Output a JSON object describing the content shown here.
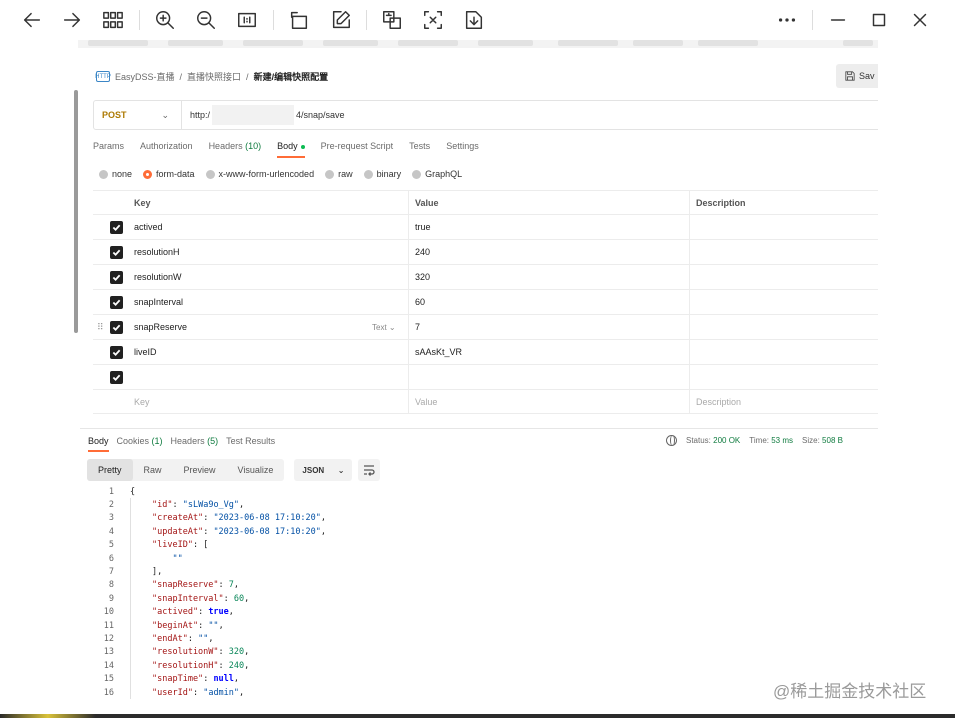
{
  "viewer": {
    "icons": [
      "back-arrow-icon",
      "forward-arrow-icon",
      "grid-view-icon",
      "zoom-in-icon",
      "zoom-out-icon",
      "actual-size-icon",
      "rotate-icon",
      "edit-icon",
      "translate-icon",
      "ocr-icon",
      "download-icon",
      "more-icon",
      "minimize-icon",
      "maximize-icon",
      "close-icon"
    ]
  },
  "breadcrumb": {
    "icon_text": "HTTP",
    "items": [
      "EasyDSS-直播",
      "直播快照接口",
      "新建/编辑快照配置"
    ]
  },
  "save_label": "Sav",
  "request": {
    "method": "POST",
    "url_prefix": "http:/",
    "url_suffix": "4/snap/save"
  },
  "req_tabs": {
    "params": "Params",
    "authorization": "Authorization",
    "headers": "Headers",
    "headers_count": "(10)",
    "body": "Body",
    "prerequest": "Pre-request Script",
    "tests": "Tests",
    "settings": "Settings"
  },
  "body_types": [
    "none",
    "form-data",
    "x-www-form-urlencoded",
    "raw",
    "binary",
    "GraphQL"
  ],
  "body_type_selected": "form-data",
  "kv_table": {
    "headers": {
      "key": "Key",
      "value": "Value",
      "description": "Description"
    },
    "rows": [
      {
        "key": "actived",
        "value": "true"
      },
      {
        "key": "resolutionH",
        "value": "240"
      },
      {
        "key": "resolutionW",
        "value": "320"
      },
      {
        "key": "snapInterval",
        "value": "60"
      },
      {
        "key": "snapReserve",
        "value": "7",
        "type": "Text"
      },
      {
        "key": "liveID",
        "value": "sAAsKt_VR"
      }
    ],
    "placeholder": {
      "key": "Key",
      "value": "Value",
      "description": "Description"
    }
  },
  "response": {
    "tabs": {
      "body": "Body",
      "cookies": "Cookies",
      "cookies_count": "(1)",
      "headers": "Headers",
      "headers_count": "(5)",
      "results": "Test Results"
    },
    "status_label": "Status:",
    "status_value": "200 OK",
    "time_label": "Time:",
    "time_value": "53 ms",
    "size_label": "Size:",
    "size_value": "508 B",
    "views": [
      "Pretty",
      "Raw",
      "Preview",
      "Visualize"
    ],
    "format": "JSON"
  },
  "code_lines": [
    {
      "n": "1",
      "t": "{"
    },
    {
      "n": "2",
      "k": "\"id\"",
      "v": "\"sLWa9o_Vg\"",
      "vt": "s",
      "tail": ","
    },
    {
      "n": "3",
      "k": "\"createAt\"",
      "v": "\"2023-06-08 17:10:20\"",
      "vt": "s",
      "tail": ","
    },
    {
      "n": "4",
      "k": "\"updateAt\"",
      "v": "\"2023-06-08 17:10:20\"",
      "vt": "s",
      "tail": ","
    },
    {
      "n": "5",
      "k": "\"liveID\"",
      "v": "[",
      "vt": "p",
      "tail": ""
    },
    {
      "n": "6",
      "t": "    \"\"",
      "cls": "s",
      "indent": true
    },
    {
      "n": "7",
      "t": "],",
      "indent1": true
    },
    {
      "n": "8",
      "k": "\"snapReserve\"",
      "v": "7",
      "vt": "n",
      "tail": ","
    },
    {
      "n": "9",
      "k": "\"snapInterval\"",
      "v": "60",
      "vt": "n",
      "tail": ","
    },
    {
      "n": "10",
      "k": "\"actived\"",
      "v": "true",
      "vt": "b",
      "tail": ","
    },
    {
      "n": "11",
      "k": "\"beginAt\"",
      "v": "\"\"",
      "vt": "s",
      "tail": ","
    },
    {
      "n": "12",
      "k": "\"endAt\"",
      "v": "\"\"",
      "vt": "s",
      "tail": ","
    },
    {
      "n": "13",
      "k": "\"resolutionW\"",
      "v": "320",
      "vt": "n",
      "tail": ","
    },
    {
      "n": "14",
      "k": "\"resolutionH\"",
      "v": "240",
      "vt": "n",
      "tail": ","
    },
    {
      "n": "15",
      "k": "\"snapTime\"",
      "v": "null",
      "vt": "b",
      "tail": ","
    },
    {
      "n": "16",
      "k": "\"userId\"",
      "v": "\"admin\"",
      "vt": "s",
      "tail": ","
    }
  ],
  "watermark": "@稀土掘金技术社区",
  "colors": {
    "accent": "#ff6c37",
    "method": "#ad7a03",
    "status_ok": "#0f7b3f",
    "json_key": "#a31515",
    "json_string": "#0451a5",
    "json_number": "#098658"
  }
}
